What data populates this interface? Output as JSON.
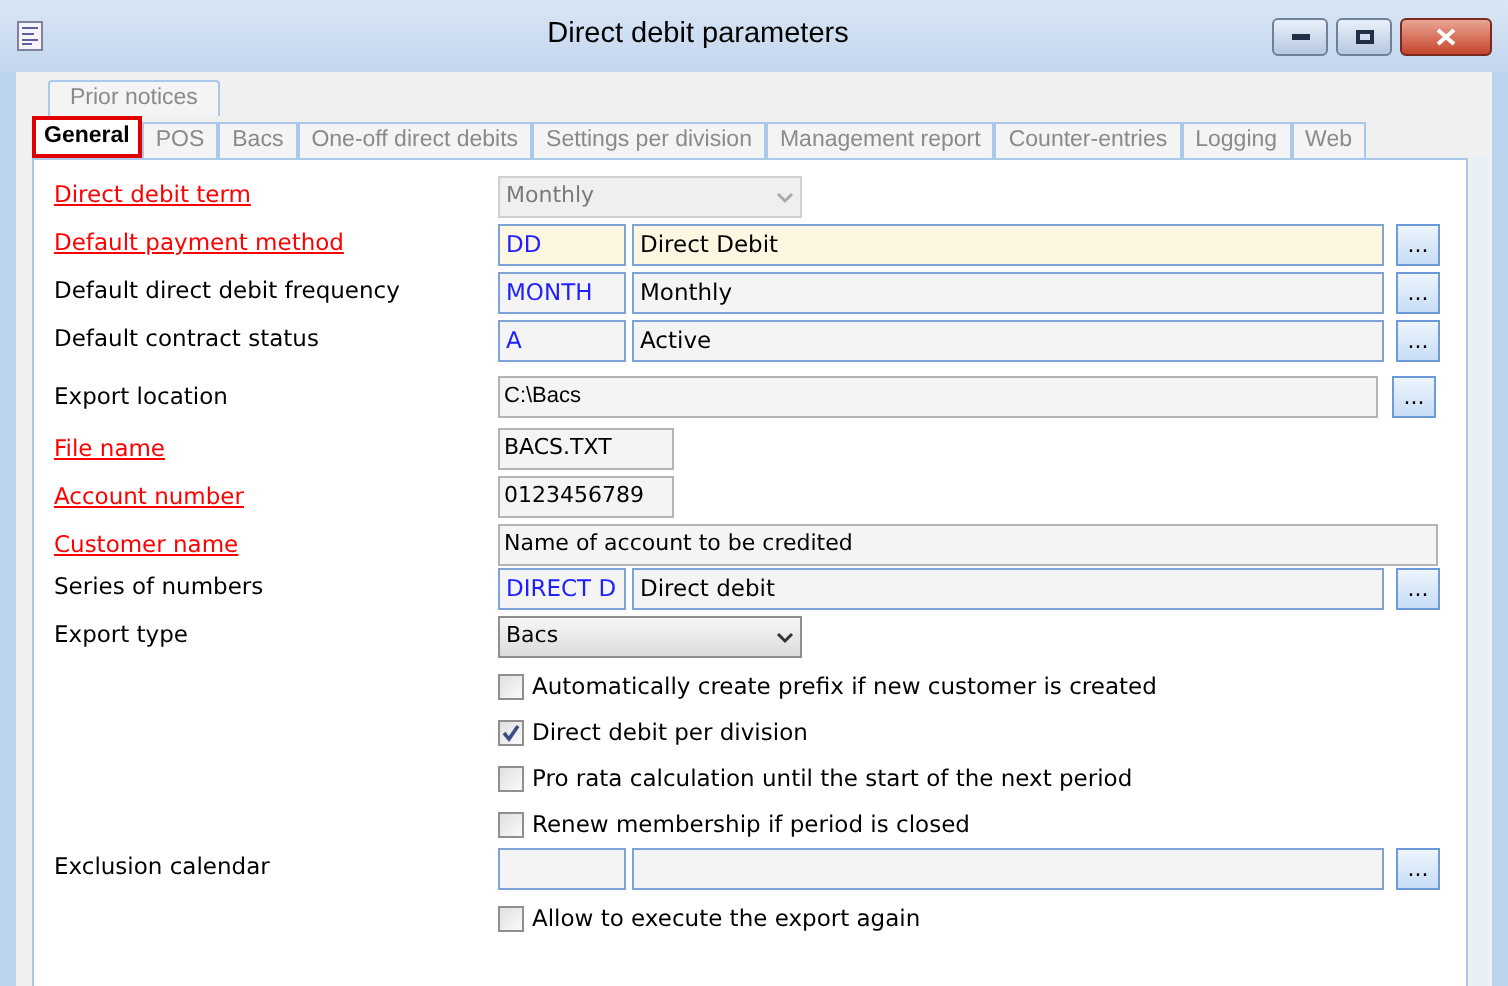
{
  "window": {
    "title": "Direct debit parameters"
  },
  "tabs_back": [
    {
      "label": "Prior notices",
      "selected": false
    }
  ],
  "tabs": [
    {
      "label": "General",
      "selected": true
    },
    {
      "label": "POS",
      "selected": false
    },
    {
      "label": "Bacs",
      "selected": false
    },
    {
      "label": "One-off direct debits",
      "selected": false
    },
    {
      "label": "Settings per division",
      "selected": false
    },
    {
      "label": "Management report",
      "selected": false
    },
    {
      "label": "Counter-entries",
      "selected": false
    },
    {
      "label": "Logging",
      "selected": false
    },
    {
      "label": "Web",
      "selected": false
    }
  ],
  "form": [
    {
      "kind": "dropdown",
      "label": "Direct debit term",
      "required": true,
      "value": "Monthly",
      "disabled": true
    },
    {
      "kind": "lookup",
      "label": "Default payment method",
      "required": true,
      "code": "DD",
      "description": "Direct Debit",
      "focused": true,
      "button": "..."
    },
    {
      "kind": "lookup",
      "label": "Default direct debit frequency",
      "required": false,
      "code": "MONTH",
      "description": "Monthly",
      "focused": false,
      "button": "..."
    },
    {
      "kind": "lookup",
      "label": "Default contract status",
      "required": false,
      "code": "A",
      "description": "Active",
      "focused": false,
      "button": "..."
    },
    {
      "kind": "path",
      "label": "Export location",
      "required": false,
      "value": "C:\\Bacs",
      "button": "..."
    },
    {
      "kind": "short",
      "label": "File name",
      "required": true,
      "value": "BACS.TXT"
    },
    {
      "kind": "short",
      "label": "Account number",
      "required": true,
      "value": "0123456789"
    },
    {
      "kind": "long",
      "label": "Customer name",
      "required": true,
      "value": "Name of account to be credited"
    },
    {
      "kind": "lookup",
      "label": "Series of numbers",
      "required": false,
      "code": "DIRECT D",
      "description": "Direct debit",
      "focused": false,
      "button": "..."
    },
    {
      "kind": "dropdown",
      "label": "Export type",
      "required": false,
      "value": "Bacs",
      "disabled": false
    },
    {
      "kind": "checkbox",
      "label": "Automatically create prefix if new customer is created",
      "checked": false
    },
    {
      "kind": "checkbox",
      "label": "Direct debit per division",
      "checked": true
    },
    {
      "kind": "checkbox",
      "label": "Pro rata calculation until the start of the next period",
      "checked": false
    },
    {
      "kind": "checkbox",
      "label": "Renew membership if period is closed",
      "checked": false
    },
    {
      "kind": "lookup",
      "label": "Exclusion calendar",
      "required": false,
      "focused": false,
      "button": "..."
    },
    {
      "kind": "checkbox",
      "label": "Allow to execute the export again",
      "checked": false
    }
  ]
}
